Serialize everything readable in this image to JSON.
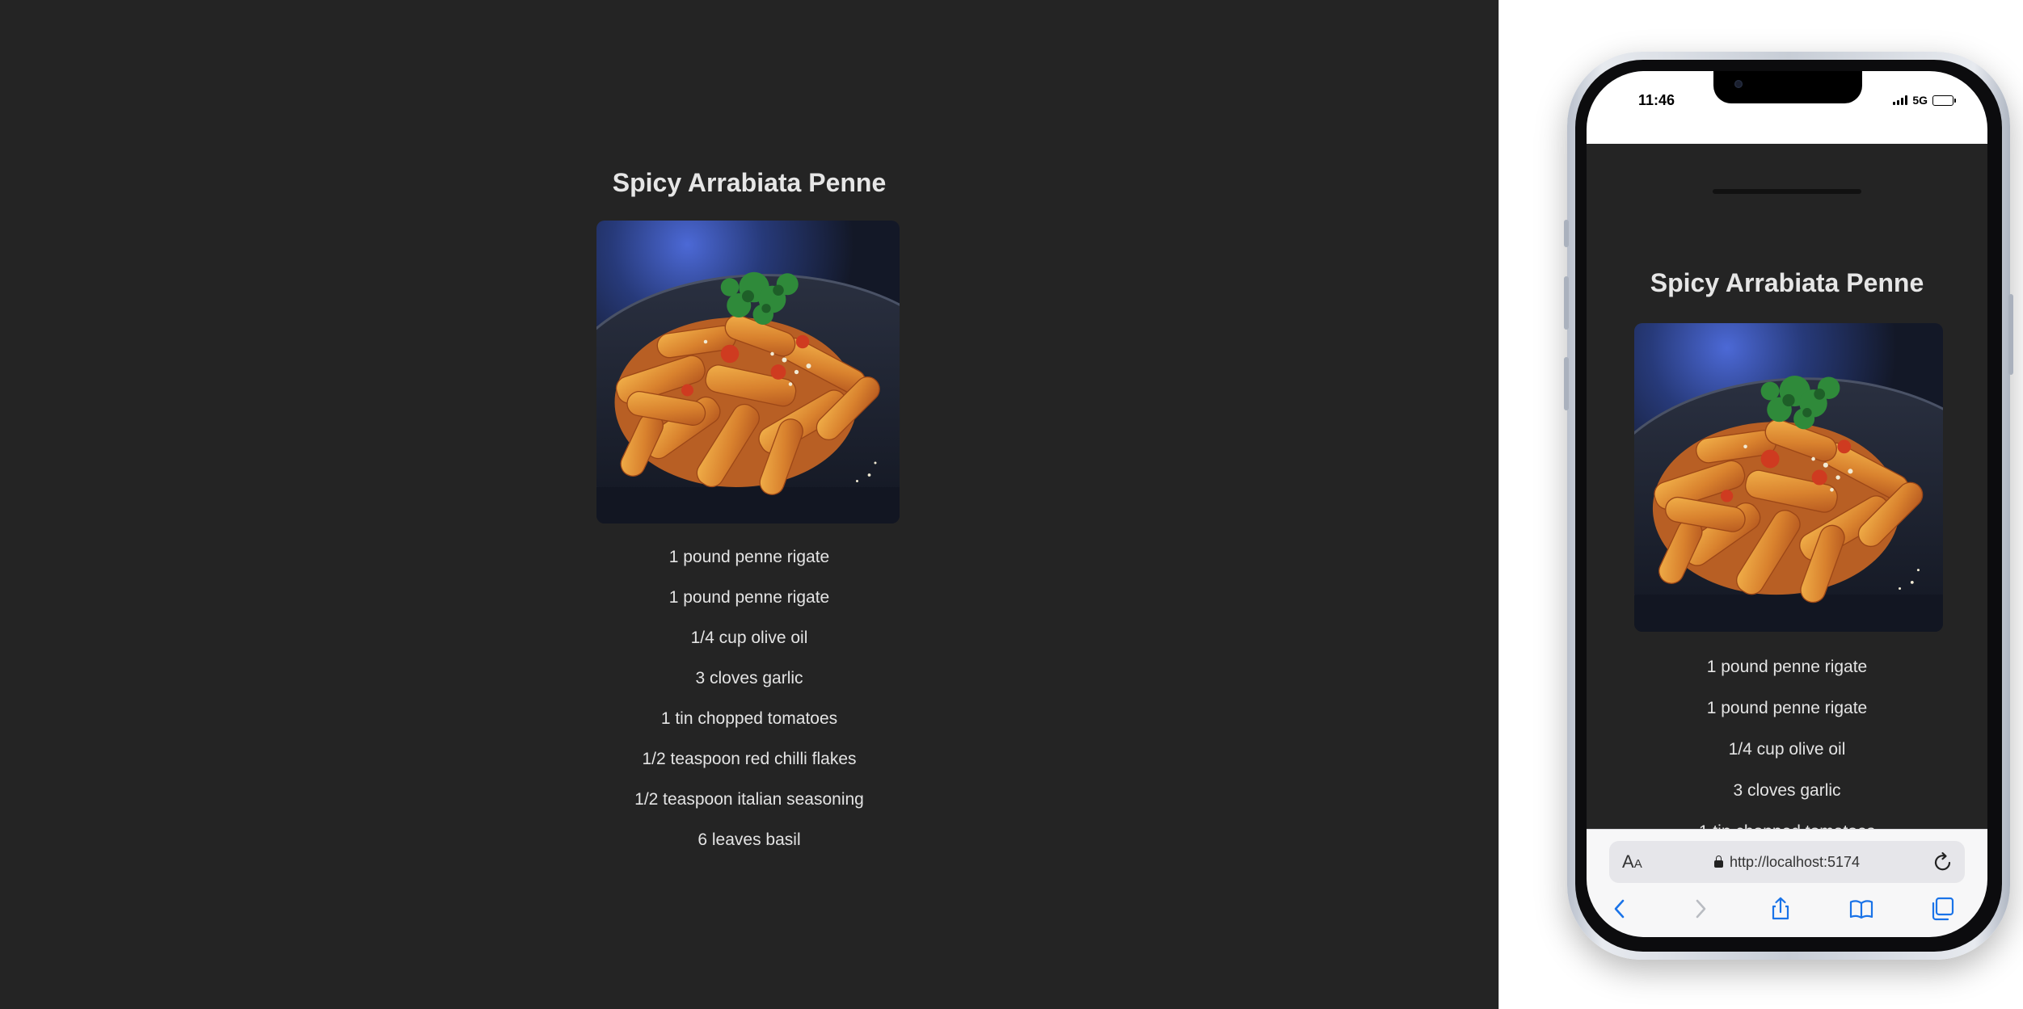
{
  "recipe": {
    "title": "Spicy Arrabiata Penne",
    "image_label": "penne pasta dish",
    "ingredients": [
      "1 pound penne rigate",
      "1 pound penne rigate",
      "1/4 cup olive oil",
      "3 cloves garlic",
      "1 tin chopped tomatoes",
      "1/2 teaspoon red chilli flakes",
      "1/2 teaspoon italian seasoning",
      "6 leaves basil"
    ]
  },
  "phone": {
    "status": {
      "time": "11:46",
      "network": "5G",
      "signal_icon": "signal-bars-icon",
      "battery_icon": "battery-icon"
    },
    "browser": {
      "reader_label": "A",
      "reader_label_small": "A",
      "url": "http://localhost:5174",
      "icons": {
        "lock": "lock-icon",
        "reload": "reload-icon",
        "back": "chevron-left-icon",
        "forward": "chevron-right-icon",
        "share": "share-icon",
        "bookmarks": "book-icon",
        "tabs": "tabs-icon"
      }
    }
  },
  "colors": {
    "page_background": "#242424",
    "text": "#e4e4e4",
    "browser_accent": "#1a73e8"
  }
}
